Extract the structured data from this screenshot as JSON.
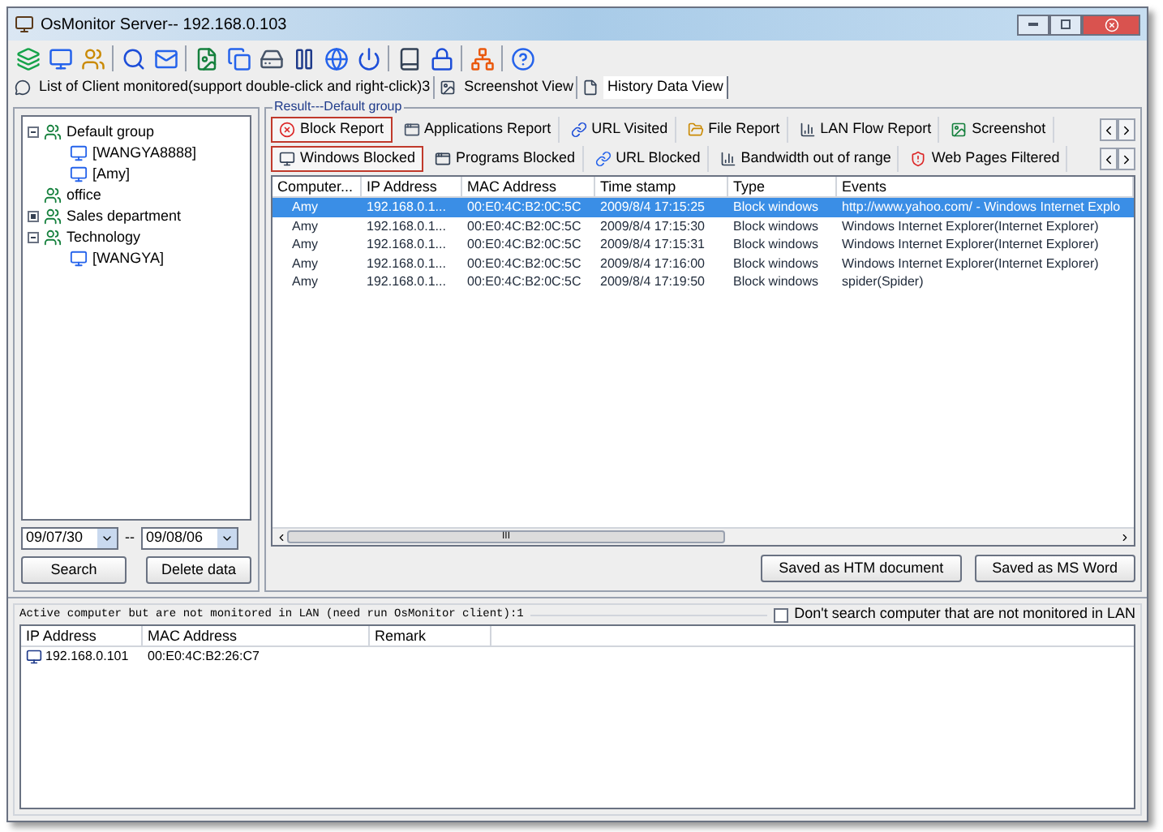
{
  "window": {
    "title": "OsMonitor Server-- 192.168.0.103"
  },
  "view_tabs": [
    {
      "label": "List of Client monitored(support double-click and right-click)3",
      "selected": false
    },
    {
      "label": "Screenshot View",
      "selected": false
    },
    {
      "label": "History Data View",
      "selected": true
    }
  ],
  "tree": [
    {
      "label": "Default group",
      "kind": "group",
      "expanded": true,
      "children": [
        {
          "label": "[WANGYA8888]",
          "kind": "computer"
        },
        {
          "label": "[Amy]",
          "kind": "computer"
        }
      ]
    },
    {
      "label": "office",
      "kind": "group"
    },
    {
      "label": "Sales department",
      "kind": "group",
      "expanded": false
    },
    {
      "label": "Technology",
      "kind": "group",
      "expanded": true,
      "children": [
        {
          "label": "[WANGYA]",
          "kind": "computer"
        }
      ]
    }
  ],
  "date_from": "09/07/30",
  "date_separator": "--",
  "date_to": "09/08/06",
  "left_buttons": [
    "Search",
    "Delete data"
  ],
  "result_title": "Result---Default group",
  "report_tabs": [
    {
      "label": "Block Report",
      "selected": true
    },
    {
      "label": "Applications Report",
      "selected": false
    },
    {
      "label": "URL Visited",
      "selected": false
    },
    {
      "label": "File Report",
      "selected": false
    },
    {
      "label": "LAN Flow Report",
      "selected": false
    },
    {
      "label": "Screenshot",
      "selected": false
    }
  ],
  "sub_tabs": [
    {
      "label": "Windows Blocked",
      "selected": true
    },
    {
      "label": "Programs Blocked",
      "selected": false
    },
    {
      "label": "URL Blocked",
      "selected": false
    },
    {
      "label": "Bandwidth out of range",
      "selected": false
    },
    {
      "label": "Web Pages Filtered",
      "selected": false
    }
  ],
  "table": {
    "columns": [
      "Computer...",
      "IP Address",
      "MAC Address",
      "Time stamp",
      "Type",
      "Events"
    ],
    "rows": [
      {
        "cells": [
          "Amy",
          "192.168.0.1...",
          "00:E0:4C:B2:0C:5C",
          "2009/8/4 17:15:25",
          "Block windows",
          "http://www.yahoo.com/ - Windows Internet Explo"
        ],
        "selected": true
      },
      {
        "cells": [
          "Amy",
          "192.168.0.1...",
          "00:E0:4C:B2:0C:5C",
          "2009/8/4 17:15:30",
          "Block windows",
          "Windows Internet Explorer(Internet Explorer)"
        ],
        "selected": false
      },
      {
        "cells": [
          "Amy",
          "192.168.0.1...",
          "00:E0:4C:B2:0C:5C",
          "2009/8/4 17:15:31",
          "Block windows",
          "Windows Internet Explorer(Internet Explorer)"
        ],
        "selected": false
      },
      {
        "cells": [
          "Amy",
          "192.168.0.1...",
          "00:E0:4C:B2:0C:5C",
          "2009/8/4 17:16:00",
          "Block windows",
          "Windows Internet Explorer(Internet Explorer)"
        ],
        "selected": false
      },
      {
        "cells": [
          "Amy",
          "192.168.0.1...",
          "00:E0:4C:B2:0C:5C",
          "2009/8/4 17:19:50",
          "Block windows",
          "spider(Spider)"
        ],
        "selected": false
      }
    ]
  },
  "scroll_grip": "III",
  "save_buttons": [
    "Saved as HTM document",
    "Saved as MS Word"
  ],
  "lan": {
    "title": "Active computer but are not monitored in LAN (need run OsMonitor client):1",
    "checkbox": {
      "label": "Don't search computer that are not monitored in LAN",
      "checked": false
    },
    "columns": [
      "IP Address",
      "MAC Address",
      "Remark"
    ],
    "rows": [
      {
        "cells": [
          "192.168.0.101",
          "00:E0:4C:B2:26:C7",
          ""
        ]
      }
    ]
  }
}
